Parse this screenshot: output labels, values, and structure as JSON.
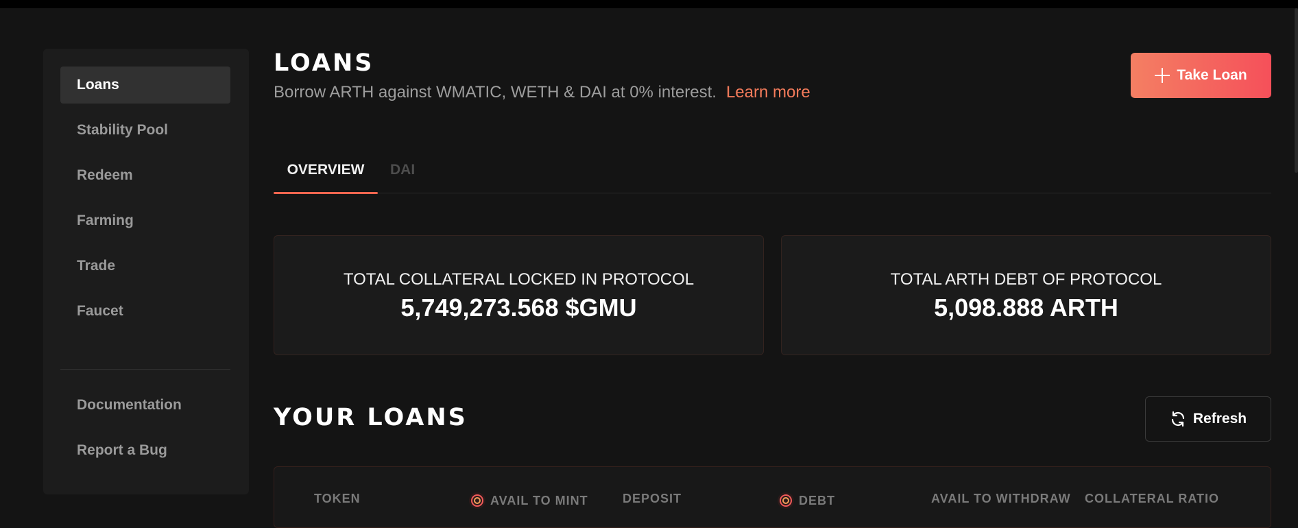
{
  "sidebar": {
    "items": [
      {
        "label": "Loans",
        "active": true
      },
      {
        "label": "Stability Pool"
      },
      {
        "label": "Redeem"
      },
      {
        "label": "Farming"
      },
      {
        "label": "Trade"
      },
      {
        "label": "Faucet"
      }
    ],
    "footer_items": [
      {
        "label": "Documentation"
      },
      {
        "label": "Report a Bug"
      }
    ]
  },
  "header": {
    "title": "LOANS",
    "subtitle": "Borrow ARTH against WMATIC, WETH & DAI at 0% interest.",
    "learn_more": "Learn more",
    "take_loan_label": "Take Loan"
  },
  "tabs": [
    {
      "label": "OVERVIEW",
      "active": true
    },
    {
      "label": "DAI"
    }
  ],
  "stats": {
    "collateral": {
      "label": "TOTAL COLLATERAL LOCKED IN PROTOCOL",
      "value": "5,749,273.568 $GMU"
    },
    "debt": {
      "label": "TOTAL ARTH DEBT OF PROTOCOL",
      "value": "5,098.888 ARTH"
    }
  },
  "loans": {
    "title": "YOUR LOANS",
    "refresh_label": "Refresh",
    "columns": [
      "TOKEN",
      "AVAIL TO MINT",
      "DEPOSIT",
      "DEBT",
      "AVAIL TO WITHDRAW",
      "COLLATERAL RATIO"
    ]
  },
  "colors": {
    "accent": "#f47b5b",
    "accent_gradient_end": "#f5505a",
    "background": "#141414",
    "panel": "#1c1c1c"
  },
  "icons": {
    "take_loan": "plus-icon",
    "refresh": "refresh-icon",
    "arth_token": "arth-coin-icon"
  }
}
